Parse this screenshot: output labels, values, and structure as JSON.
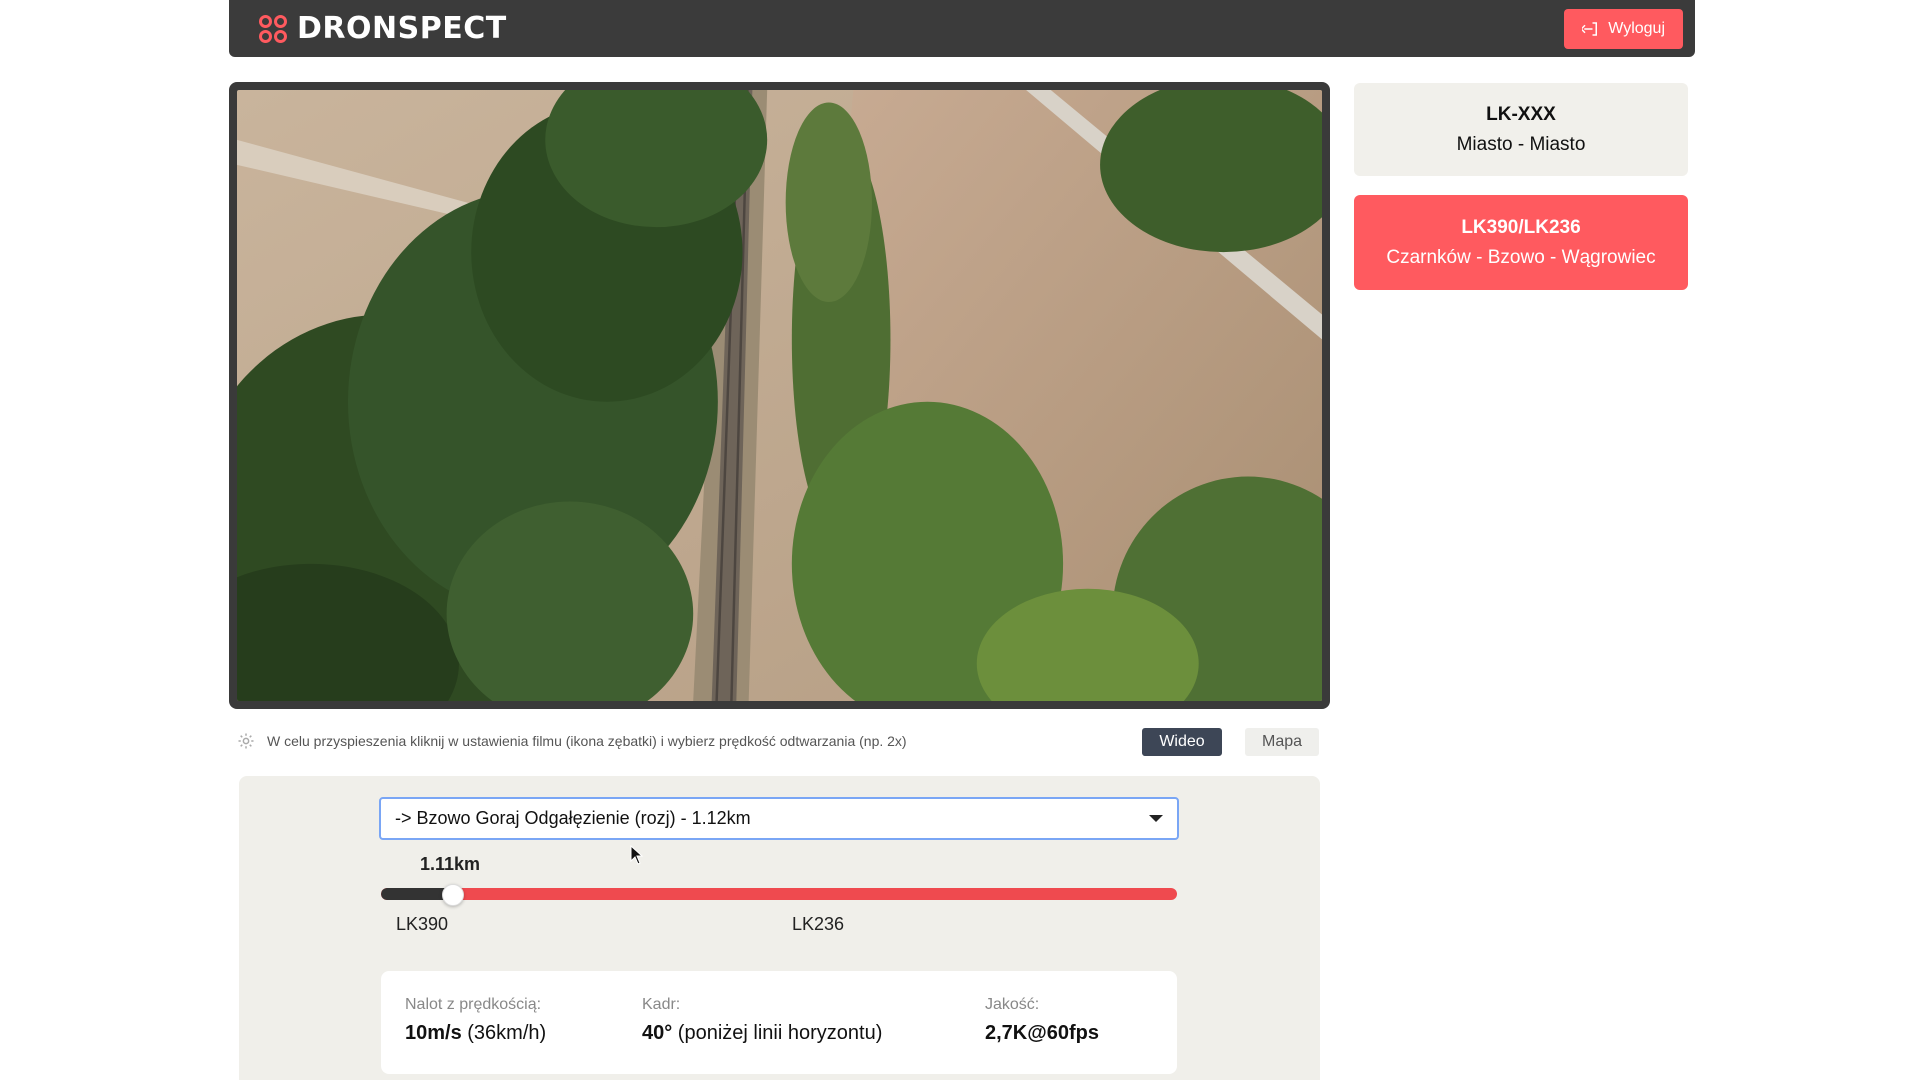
{
  "header": {
    "brand": "DRONSPECT",
    "logout_label": "Wyloguj"
  },
  "routes": [
    {
      "title": "LK-XXX",
      "subtitle": "Miasto - Miasto",
      "active": false
    },
    {
      "title": "LK390/LK236",
      "subtitle": "Czarnków - Bzowo - Wągrowiec",
      "active": true
    }
  ],
  "hint": {
    "text": "W celu przyspieszenia kliknij w ustawienia filmu (ikona zębatki) i wybierz prędkość odtwarzania (np. 2x)"
  },
  "view_toggle": {
    "video_label": "Wideo",
    "map_label": "Mapa",
    "selected": "Wideo"
  },
  "segment_select": {
    "value": "-> Bzowo Goraj Odgałęzienie (rozj) - 1.12km"
  },
  "slider": {
    "position_label": "1.11km",
    "progress_fraction": 0.09,
    "start_label": "LK390",
    "mid_label": "LK236"
  },
  "flight_info": {
    "speed_label": "Nalot z prędkością:",
    "speed_value_bold": "10m/s",
    "speed_value_rest": " (36km/h)",
    "frame_label": "Kadr:",
    "frame_value_bold": "40°",
    "frame_value_rest": " (poniżej linii horyzontu)",
    "quality_label": "Jakość:",
    "quality_value": "2,7K@60fps"
  },
  "colors": {
    "accent": "#ff5a5f",
    "header_bg": "#3b3b3b",
    "selected_toggle": "#3d4656"
  }
}
